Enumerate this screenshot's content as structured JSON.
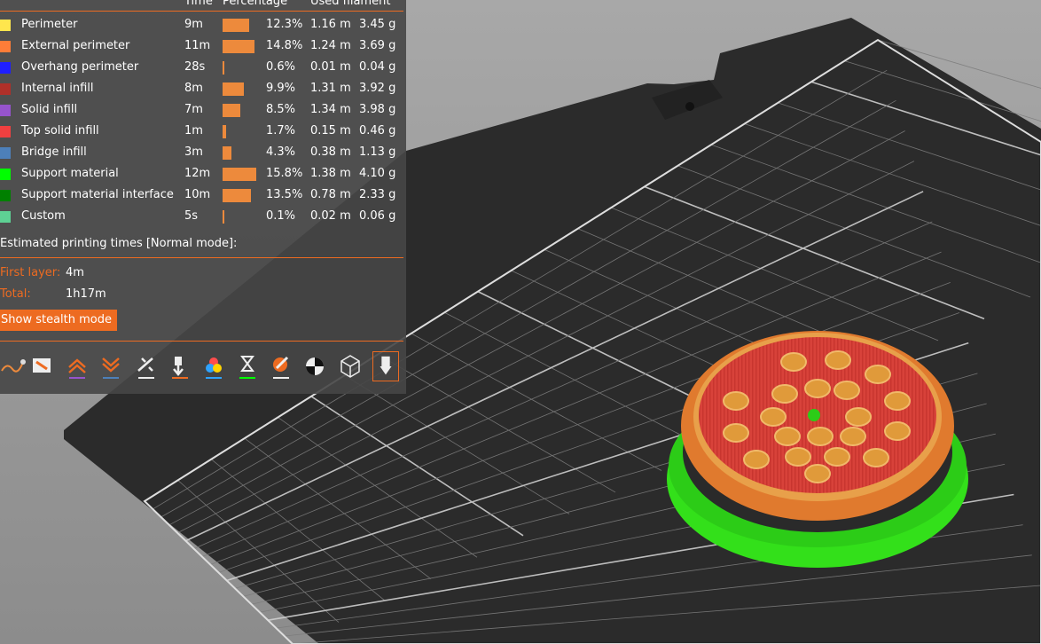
{
  "legend": {
    "headers": {
      "time": "Time",
      "percentage": "Percentage",
      "used_filament": "Used filament"
    },
    "rows": [
      {
        "label": "Perimeter",
        "color": "#ffe64d",
        "time": "9m",
        "percent_value": 12.3,
        "percentage": "12.3%",
        "length": "1.16 m",
        "weight": "3.45 g"
      },
      {
        "label": "External perimeter",
        "color": "#ff7d38",
        "time": "11m",
        "percent_value": 14.8,
        "percentage": "14.8%",
        "length": "1.24 m",
        "weight": "3.69 g"
      },
      {
        "label": "Overhang perimeter",
        "color": "#1f1fff",
        "time": "28s",
        "percent_value": 0.6,
        "percentage": "0.6%",
        "length": "0.01 m",
        "weight": "0.04 g"
      },
      {
        "label": "Internal infill",
        "color": "#b03029",
        "time": "8m",
        "percent_value": 9.9,
        "percentage": "9.9%",
        "length": "1.31 m",
        "weight": "3.92 g"
      },
      {
        "label": "Solid infill",
        "color": "#9654cc",
        "time": "7m",
        "percent_value": 8.5,
        "percentage": "8.5%",
        "length": "1.34 m",
        "weight": "3.98 g"
      },
      {
        "label": "Top solid infill",
        "color": "#f04040",
        "time": "1m",
        "percent_value": 1.7,
        "percentage": "1.7%",
        "length": "0.15 m",
        "weight": "0.46 g"
      },
      {
        "label": "Bridge infill",
        "color": "#4d80ba",
        "time": "3m",
        "percent_value": 4.3,
        "percentage": "4.3%",
        "length": "0.38 m",
        "weight": "1.13 g"
      },
      {
        "label": "Support material",
        "color": "#00ff00",
        "time": "12m",
        "percent_value": 15.8,
        "percentage": "15.8%",
        "length": "1.38 m",
        "weight": "4.10 g"
      },
      {
        "label": "Support material interface",
        "color": "#008000",
        "time": "10m",
        "percent_value": 13.5,
        "percentage": "13.5%",
        "length": "0.78 m",
        "weight": "2.33 g"
      },
      {
        "label": "Custom",
        "color": "#5ed194",
        "time": "5s",
        "percent_value": 0.1,
        "percentage": "0.1%",
        "length": "0.02 m",
        "weight": "0.06 g"
      }
    ]
  },
  "estimates": {
    "title": "Estimated printing times [Normal mode]:",
    "first_layer_label": "First layer:",
    "first_layer_value": "4m",
    "total_label": "Total:",
    "total_value": "1h17m",
    "stealth_button": "Show stealth mode"
  },
  "toolbar": {
    "icons": [
      "travel-icon",
      "wipe-icon",
      "retractions-icon",
      "deretractions-icon",
      "seams-icon",
      "tool-changes-icon",
      "color-changes-icon",
      "pause-prints-icon",
      "custom-gcodes-icon",
      "center-of-gravity-icon",
      "shells-icon",
      "tool-marker-icon"
    ]
  },
  "colors": {
    "accent": "#ed6b21",
    "bar": "#ed8a3c",
    "panel": "#464646",
    "bed": "#2c2c2c",
    "background": "#9a9a9a",
    "model_top": "#d8423a",
    "model_wall": "#e07a2e",
    "support": "#33e01a"
  }
}
